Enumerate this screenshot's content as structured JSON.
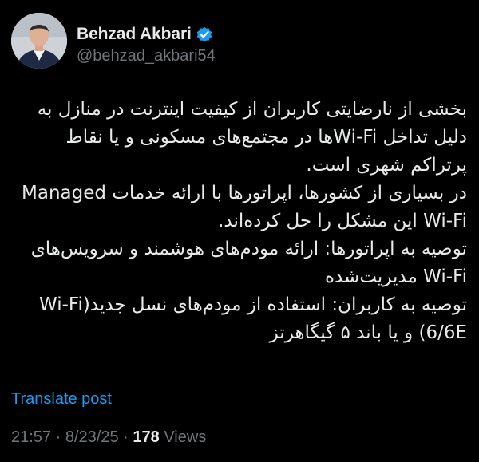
{
  "author": {
    "display_name": "Behzad Akbari",
    "handle": "@behzad_akbari54",
    "verified_badge_icon": "verified-badge-icon",
    "avatar_icon": "avatar-photo"
  },
  "post": {
    "lines": [
      "بخشی از نارضایتی کاربران از کیفیت اینترنت در منازل به",
      "دلیل تداخل Wi-Fiها در مجتمع‌های مسکونی و یا نقاط",
      "پرتراکم شهری است.",
      "در بسیاری از کشورها، اپراتورها با ارائه خدمات Managed",
      "Wi-Fi این مشکل را حل کرده‌اند.",
      "توصیه به اپراتورها: ارائه مودم‌های هوشمند و سرویس‌های",
      "Wi-Fi مدیریت‌شده",
      "توصیه به کاربران: استفاده از مودم‌های نسل جدید(Wi-Fi",
      "6/6E) و یا باند ۵ گیگاهرتز"
    ]
  },
  "translate_label": "Translate post",
  "meta": {
    "time": "21:57",
    "separator": "·",
    "date": "8/23/25",
    "views_count": "178",
    "views_label": "Views"
  },
  "colors": {
    "background": "#000000",
    "text": "#e7e9ea",
    "secondary": "#71767b",
    "accent": "#1d9bf0"
  }
}
